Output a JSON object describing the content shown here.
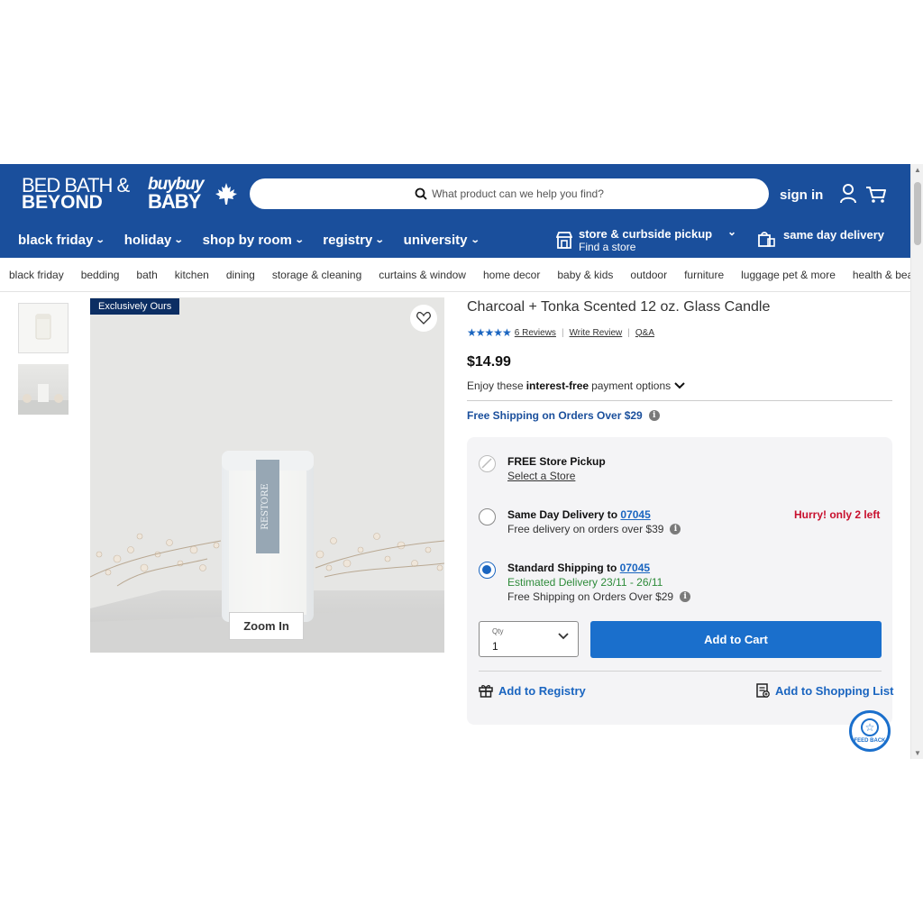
{
  "header": {
    "logo_line1": "BED BATH &",
    "logo_line2": "BEYOND",
    "logo2_line1": "buybuy",
    "logo2_line2": "BABY",
    "search_placeholder": "What product can we help you find?",
    "signin": "sign in",
    "nav": [
      "black friday",
      "holiday",
      "shop by room",
      "registry",
      "university"
    ],
    "store_title": "store & curbside pickup",
    "store_sub": "Find a store",
    "same_day": "same day delivery",
    "brand_color": "#1a4f9c"
  },
  "categories": [
    "black friday",
    "bedding",
    "bath",
    "kitchen",
    "dining",
    "storage & cleaning",
    "curtains & window",
    "home decor",
    "baby & kids",
    "outdoor",
    "furniture",
    "luggage pet & more",
    "health & beauty"
  ],
  "gallery": {
    "badge": "Exclusively Ours",
    "zoom": "Zoom In",
    "label_text": "RESTORE"
  },
  "product": {
    "title": "Charcoal + Tonka Scented 12 oz. Glass Candle",
    "rating": 5,
    "reviews": "6 Reviews",
    "write_review": "Write Review",
    "qa": "Q&A",
    "price": "$14.99",
    "enjoy_pre": "Enjoy these",
    "enjoy_bold": "interest-free",
    "enjoy_post": "payment options",
    "free_shipping": "Free Shipping on Orders Over $29"
  },
  "fulfillment": {
    "pickup_title": "FREE Store Pickup",
    "pickup_link": "Select a Store",
    "sameday_title": "Same Day Delivery to",
    "sameday_zip": "07045",
    "sameday_sub": "Free delivery on orders over $39",
    "hurry": "Hurry! only 2 left",
    "standard_title": "Standard Shipping to",
    "standard_zip": "07045",
    "standard_est": "Estimated Delivery 23/11 - 26/11",
    "standard_sub": "Free Shipping on Orders Over $29",
    "selected": "standard"
  },
  "cart": {
    "qty_label": "Qty",
    "qty_value": "1",
    "add_to_cart": "Add to Cart",
    "add_to_registry": "Add to Registry",
    "add_to_list": "Add to Shopping List"
  },
  "feedback": "FEED BACK"
}
